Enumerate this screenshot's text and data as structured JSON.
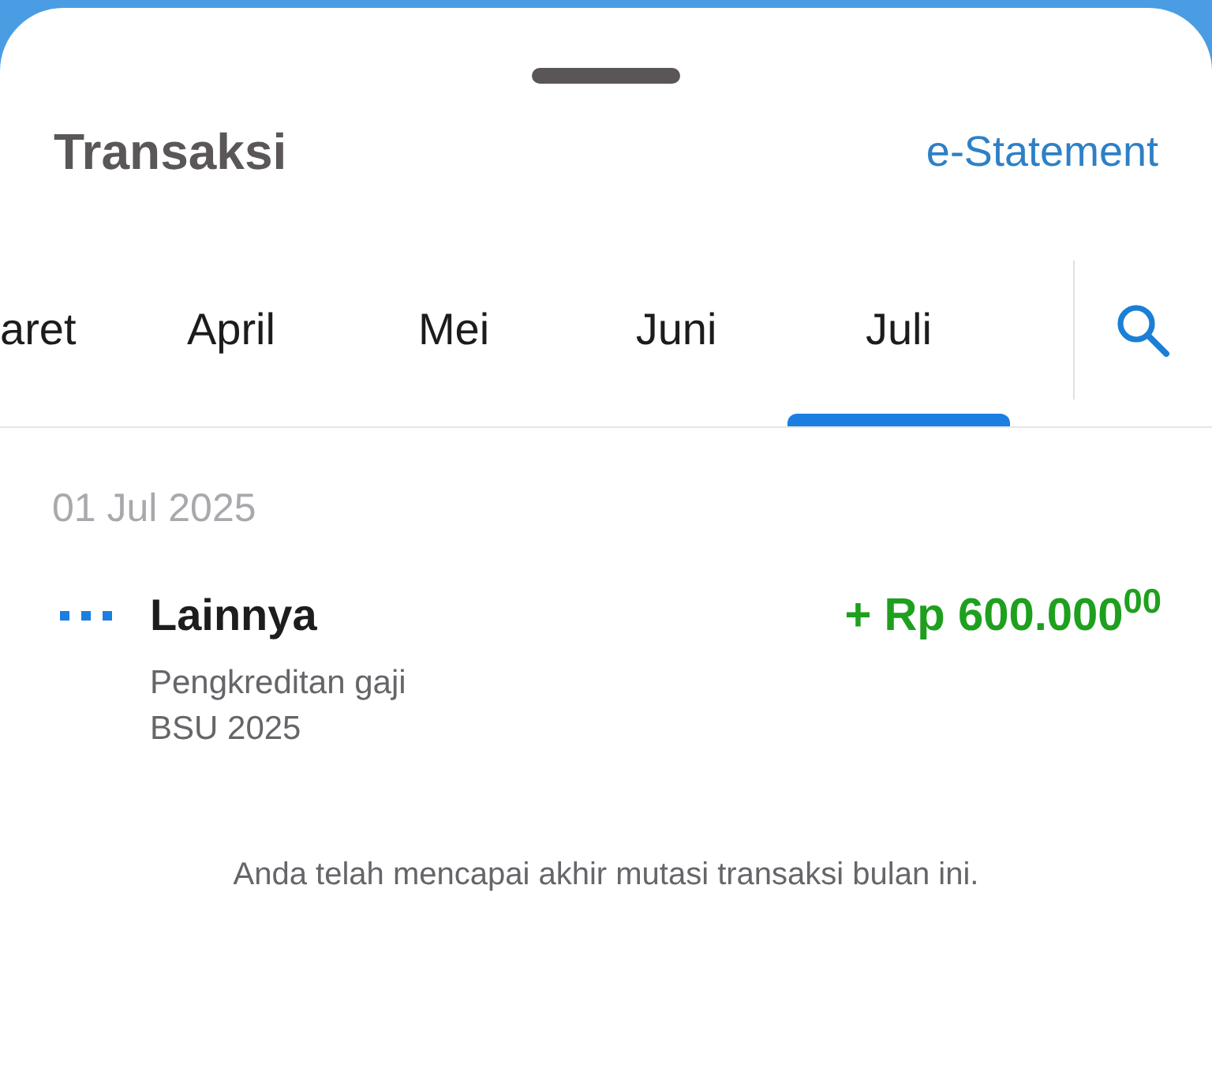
{
  "header": {
    "title": "Transaksi",
    "link": "e-Statement"
  },
  "tabs": [
    {
      "label": "aret",
      "selected": false
    },
    {
      "label": "April",
      "selected": false
    },
    {
      "label": "Mei",
      "selected": false
    },
    {
      "label": "Juni",
      "selected": false
    },
    {
      "label": "Juli",
      "selected": true
    }
  ],
  "groups": [
    {
      "date": "01 Jul 2025",
      "transactions": [
        {
          "category": "Lainnya",
          "description": "Pengkreditan gaji BSU 2025",
          "amount": "+ Rp 600.000$^{00}$",
          "kind": "credit"
        }
      ]
    }
  ],
  "end_message": "Anda telah mencapai akhir mutasi transaksi bulan ini."
}
